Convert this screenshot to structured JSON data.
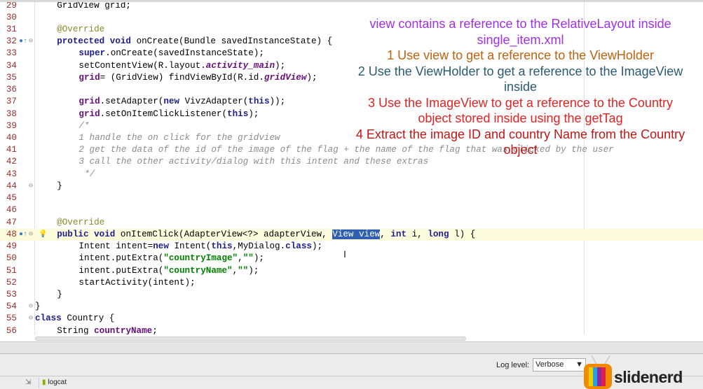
{
  "editor": {
    "lines": [
      {
        "n": "29",
        "indent": 4,
        "tokens": [
          [
            "GridView grid;",
            "plain"
          ]
        ]
      },
      {
        "n": "30",
        "indent": 0,
        "tokens": []
      },
      {
        "n": "31",
        "indent": 4,
        "tokens": [
          [
            "@Override",
            "ann"
          ]
        ]
      },
      {
        "n": "32",
        "indent": 4,
        "icon": "override-icon",
        "fold": true,
        "tokens": [
          [
            "protected void ",
            "kw"
          ],
          [
            "onCreate(Bundle savedInstanceState) {",
            "plain"
          ]
        ]
      },
      {
        "n": "33",
        "indent": 8,
        "tokens": [
          [
            "super",
            "kw"
          ],
          [
            ".onCreate(savedInstanceState);",
            "plain"
          ]
        ]
      },
      {
        "n": "34",
        "indent": 8,
        "tokens": [
          [
            "setContentView(R.layout.",
            "plain"
          ],
          [
            "activity_main",
            "sfld"
          ],
          [
            ");",
            "plain"
          ]
        ]
      },
      {
        "n": "35",
        "indent": 8,
        "tokens": [
          [
            "grid",
            "fld"
          ],
          [
            "= (GridView) findViewById(R.id.",
            "plain"
          ],
          [
            "gridView",
            "sfld"
          ],
          [
            ");",
            "plain"
          ]
        ]
      },
      {
        "n": "36",
        "indent": 0,
        "tokens": []
      },
      {
        "n": "37",
        "indent": 8,
        "tokens": [
          [
            "grid",
            "fld"
          ],
          [
            ".setAdapter(",
            "plain"
          ],
          [
            "new ",
            "kw"
          ],
          [
            "VivzAdapter(",
            "plain"
          ],
          [
            "this",
            "kw"
          ],
          [
            "));",
            "plain"
          ]
        ]
      },
      {
        "n": "38",
        "indent": 8,
        "tokens": [
          [
            "grid",
            "fld"
          ],
          [
            ".setOnItemClickListener(",
            "plain"
          ],
          [
            "this",
            "kw"
          ],
          [
            ");",
            "plain"
          ]
        ]
      },
      {
        "n": "39",
        "indent": 8,
        "tokens": [
          [
            "/*",
            "cmt"
          ]
        ]
      },
      {
        "n": "40",
        "indent": 8,
        "tokens": [
          [
            "1 handle the on click for the gridview",
            "cmt"
          ]
        ]
      },
      {
        "n": "41",
        "indent": 8,
        "tokens": [
          [
            "2 get the data of the id of the image of the flag + the name of the flag that was clicked by the user",
            "cmt"
          ]
        ]
      },
      {
        "n": "42",
        "indent": 8,
        "tokens": [
          [
            "3 call the other activity/dialog with this intent and these extras",
            "cmt"
          ]
        ]
      },
      {
        "n": "43",
        "indent": 9,
        "tokens": [
          [
            "*/",
            "cmt"
          ]
        ]
      },
      {
        "n": "44",
        "indent": 4,
        "fold": true,
        "tokens": [
          [
            "}",
            "plain"
          ]
        ]
      },
      {
        "n": "45",
        "indent": 0,
        "tokens": []
      },
      {
        "n": "46",
        "indent": 0,
        "tokens": []
      },
      {
        "n": "47",
        "indent": 4,
        "tokens": [
          [
            "@Override",
            "ann"
          ]
        ]
      },
      {
        "n": "48",
        "indent": 4,
        "icon": "override-icon",
        "bulb": true,
        "fold": true,
        "current": true,
        "tokens": [
          [
            "public void ",
            "kw"
          ],
          [
            "onItemClick(AdapterView<?> adapterView, ",
            "plain"
          ],
          [
            "View view",
            "sel"
          ],
          [
            ", ",
            "plain"
          ],
          [
            "int ",
            "kw"
          ],
          [
            "i, ",
            "plain"
          ],
          [
            "long ",
            "kw"
          ],
          [
            "l) {",
            "plain"
          ]
        ]
      },
      {
        "n": "49",
        "indent": 8,
        "tokens": [
          [
            "Intent intent=",
            "plain"
          ],
          [
            "new ",
            "kw"
          ],
          [
            "Intent(",
            "plain"
          ],
          [
            "this",
            "kw"
          ],
          [
            ",MyDialog.",
            "plain"
          ],
          [
            "class",
            "kw"
          ],
          [
            ");",
            "plain"
          ]
        ]
      },
      {
        "n": "50",
        "indent": 8,
        "tokens": [
          [
            "intent.putExtra(",
            "plain"
          ],
          [
            "\"countryImage\"",
            "str"
          ],
          [
            ",",
            "plain"
          ],
          [
            "\"\"",
            "str"
          ],
          [
            ");",
            "plain"
          ]
        ]
      },
      {
        "n": "51",
        "indent": 8,
        "tokens": [
          [
            "intent.putExtra(",
            "plain"
          ],
          [
            "\"countryName\"",
            "str"
          ],
          [
            ",",
            "plain"
          ],
          [
            "\"\"",
            "str"
          ],
          [
            ");",
            "plain"
          ]
        ]
      },
      {
        "n": "52",
        "indent": 8,
        "tokens": [
          [
            "startActivity(intent);",
            "plain"
          ]
        ]
      },
      {
        "n": "53",
        "indent": 4,
        "tokens": [
          [
            "}",
            "plain"
          ]
        ]
      },
      {
        "n": "54",
        "indent": 0,
        "fold": true,
        "tokens": [
          [
            "}",
            "plain"
          ]
        ]
      },
      {
        "n": "55",
        "indent": 0,
        "fold": true,
        "tokens": [
          [
            "class ",
            "kw"
          ],
          [
            "Country {",
            "plain"
          ]
        ]
      },
      {
        "n": "56",
        "indent": 4,
        "tokens": [
          [
            "String ",
            "plain"
          ],
          [
            "countryName",
            "fld"
          ],
          [
            ";",
            "plain"
          ]
        ]
      }
    ]
  },
  "notes": [
    {
      "text": "view contains a reference to the RelativeLayout inside single_item.xml",
      "color": "#a030e8"
    },
    {
      "text": "1 Use view to get a reference to the ViewHolder",
      "color": "#c0620f"
    },
    {
      "text": "2 Use the ViewHolder to get a reference to the ImageView inside",
      "color": "#2b5a72"
    },
    {
      "text": "3 Use the ImageView to get a reference to the Country object stored inside using the getTag",
      "color": "#e32222"
    },
    {
      "text": "4 Extract the image ID and country Name from the Country object",
      "color": "#c21616"
    }
  ],
  "logpanel": {
    "log_level_label": "Log level:",
    "log_level_value": "Verbose"
  },
  "bottom": {
    "logcat_tab": "logcat"
  },
  "logo": {
    "text": "slidenerd"
  }
}
